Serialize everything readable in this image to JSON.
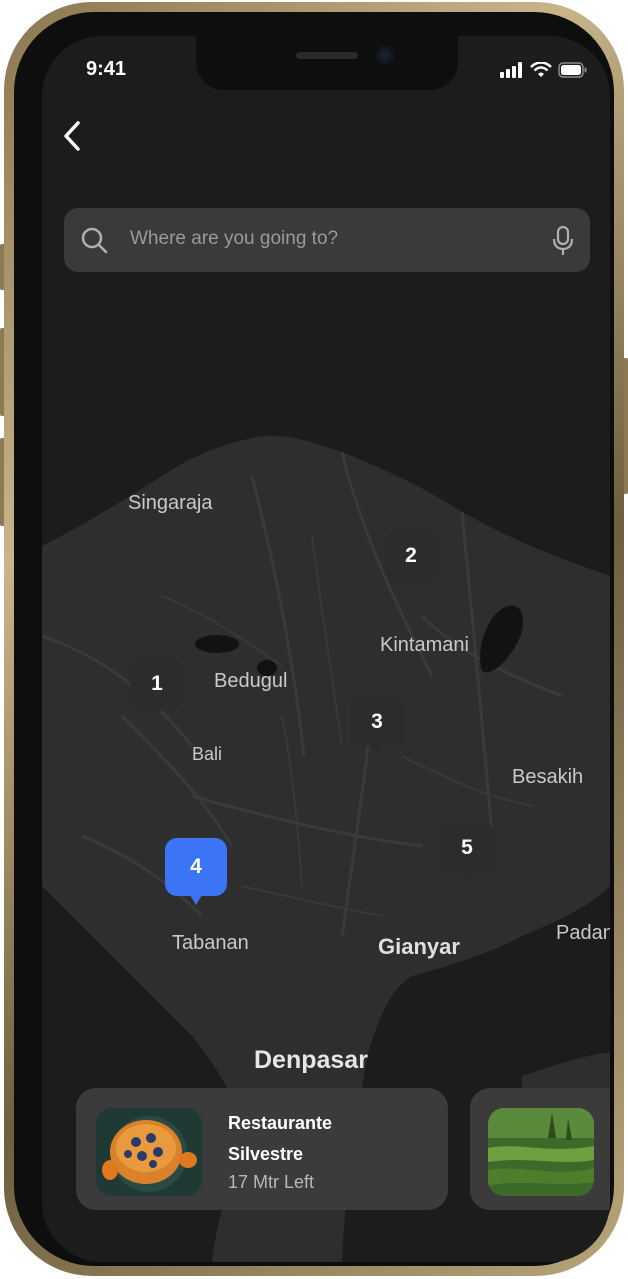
{
  "status_bar": {
    "time": "9:41"
  },
  "search": {
    "placeholder": "Where are you going to?"
  },
  "map": {
    "labels": {
      "singaraja": "Singaraja",
      "kintamani": "Kintamani",
      "bedugul": "Bedugul",
      "bali": "Bali",
      "besakih": "Besakih",
      "tabanan": "Tabanan",
      "gianyar": "Gianyar",
      "padan": "Padan",
      "denpasar": "Denpasar"
    },
    "markers": [
      "1",
      "2",
      "3",
      "4",
      "5"
    ],
    "active_marker": "4",
    "active_color": "#3b74f5"
  },
  "place_cards": [
    {
      "title_line1": "Restaurante",
      "title_line2": "Silvestre",
      "distance": "17 Mtr Left"
    }
  ]
}
